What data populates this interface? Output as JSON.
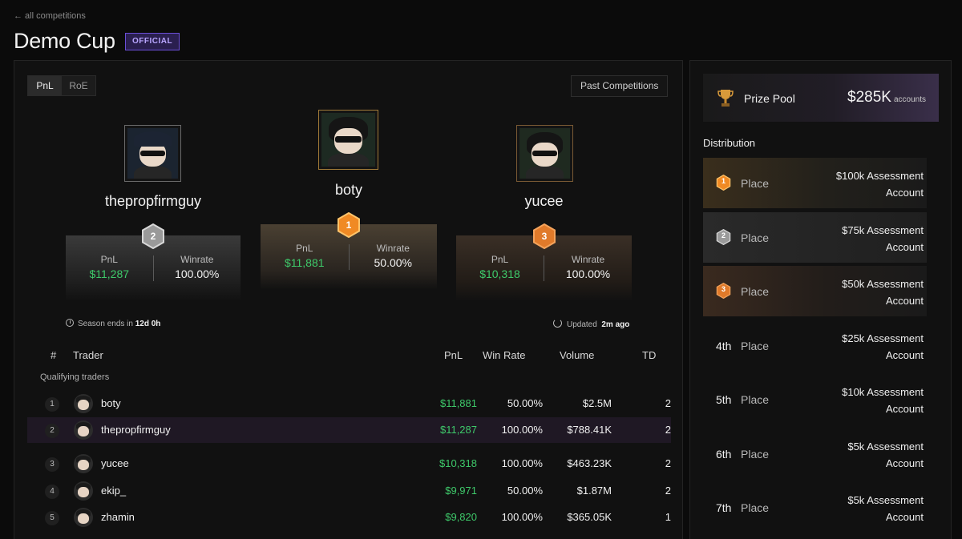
{
  "nav": {
    "back_label": "← all competitions"
  },
  "header": {
    "title": "Demo Cup",
    "badge": "OFFICIAL"
  },
  "toggle": {
    "options": [
      "PnL",
      "RoE"
    ],
    "active": "PnL"
  },
  "past_button": "Past Competitions",
  "podium": [
    {
      "rank": "2",
      "name": "thepropfirmguy",
      "pnl_label": "PnL",
      "pnl": "$11,287",
      "winrate_label": "Winrate",
      "winrate": "100.00%"
    },
    {
      "rank": "1",
      "name": "boty",
      "pnl_label": "PnL",
      "pnl": "$11,881",
      "winrate_label": "Winrate",
      "winrate": "50.00%"
    },
    {
      "rank": "3",
      "name": "yucee",
      "pnl_label": "PnL",
      "pnl": "$10,318",
      "winrate_label": "Winrate",
      "winrate": "100.00%"
    }
  ],
  "season": {
    "prefix": "Season ends in",
    "value": "12d 0h"
  },
  "updated": {
    "prefix": "Updated",
    "value": "2m ago"
  },
  "table": {
    "columns": {
      "rank": "#",
      "trader": "Trader",
      "pnl": "PnL",
      "winrate": "Win Rate",
      "volume": "Volume",
      "td": "TD"
    },
    "group_label": "Qualifying traders",
    "rows": [
      {
        "rank": "1",
        "trader": "boty",
        "pnl": "$11,881",
        "winrate": "50.00%",
        "volume": "$2.5M",
        "td": "2"
      },
      {
        "rank": "2",
        "trader": "thepropfirmguy",
        "pnl": "$11,287",
        "winrate": "100.00%",
        "volume": "$788.41K",
        "td": "2"
      },
      {
        "rank": "3",
        "trader": "yucee",
        "pnl": "$10,318",
        "winrate": "100.00%",
        "volume": "$463.23K",
        "td": "2"
      },
      {
        "rank": "4",
        "trader": "ekip_",
        "pnl": "$9,971",
        "winrate": "50.00%",
        "volume": "$1.87M",
        "td": "2"
      },
      {
        "rank": "5",
        "trader": "zhamin",
        "pnl": "$9,820",
        "winrate": "100.00%",
        "volume": "$365.05K",
        "td": "1"
      }
    ]
  },
  "prize_pool": {
    "label": "Prize Pool",
    "value": "$285K",
    "unit": "accounts"
  },
  "distribution": {
    "title": "Distribution",
    "items": [
      {
        "place": "1",
        "label": "Place",
        "prize_line1": "$100k Assessment",
        "prize_line2": "Account"
      },
      {
        "place": "2",
        "label": "Place",
        "prize_line1": "$75k Assessment",
        "prize_line2": "Account"
      },
      {
        "place": "3",
        "label": "Place",
        "prize_line1": "$50k Assessment",
        "prize_line2": "Account"
      },
      {
        "place": "4th",
        "label": "Place",
        "prize_line1": "$25k Assessment",
        "prize_line2": "Account"
      },
      {
        "place": "5th",
        "label": "Place",
        "prize_line1": "$10k Assessment",
        "prize_line2": "Account"
      },
      {
        "place": "6th",
        "label": "Place",
        "prize_line1": "$5k Assessment",
        "prize_line2": "Account"
      },
      {
        "place": "7th",
        "label": "Place",
        "prize_line1": "$5k Assessment",
        "prize_line2": "Account"
      }
    ]
  },
  "colors": {
    "accent_purple": "#6b4fd8",
    "gain_green": "#3ec96a",
    "gold": "#f08a24",
    "silver": "#8a8a8a",
    "bronze": "#e07a2a"
  }
}
